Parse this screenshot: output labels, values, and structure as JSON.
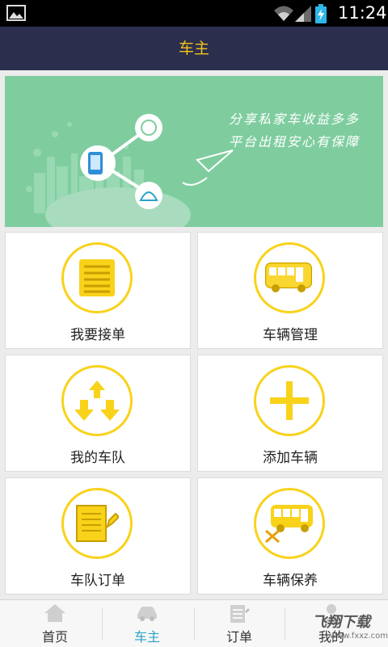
{
  "status_bar": {
    "time": "11:24"
  },
  "header": {
    "title": "车主"
  },
  "banner": {
    "line1": "分享私家车收益多多",
    "line2": "平台出租安心有保障"
  },
  "tiles": [
    {
      "label": "我要接单",
      "icon": "list-icon"
    },
    {
      "label": "车辆管理",
      "icon": "bus-icon"
    },
    {
      "label": "我的车队",
      "icon": "fleet-arrows-icon"
    },
    {
      "label": "添加车辆",
      "icon": "plus-icon"
    },
    {
      "label": "车队订单",
      "icon": "order-document-icon"
    },
    {
      "label": "车辆保养",
      "icon": "bus-maintenance-icon"
    }
  ],
  "tabs": [
    {
      "label": "首页",
      "icon": "home-icon"
    },
    {
      "label": "车主",
      "icon": "car-icon",
      "active": true
    },
    {
      "label": "订单",
      "icon": "order-icon"
    },
    {
      "label": "我的",
      "icon": "person-icon"
    }
  ],
  "watermark": {
    "line1": "飞翔下载",
    "line2": "www.fxxz.com"
  },
  "colors": {
    "header_bg": "#2b2f4d",
    "accent": "#f2c31b",
    "banner_bg": "#7fcd9f",
    "active_tab": "#2aa3c9"
  }
}
